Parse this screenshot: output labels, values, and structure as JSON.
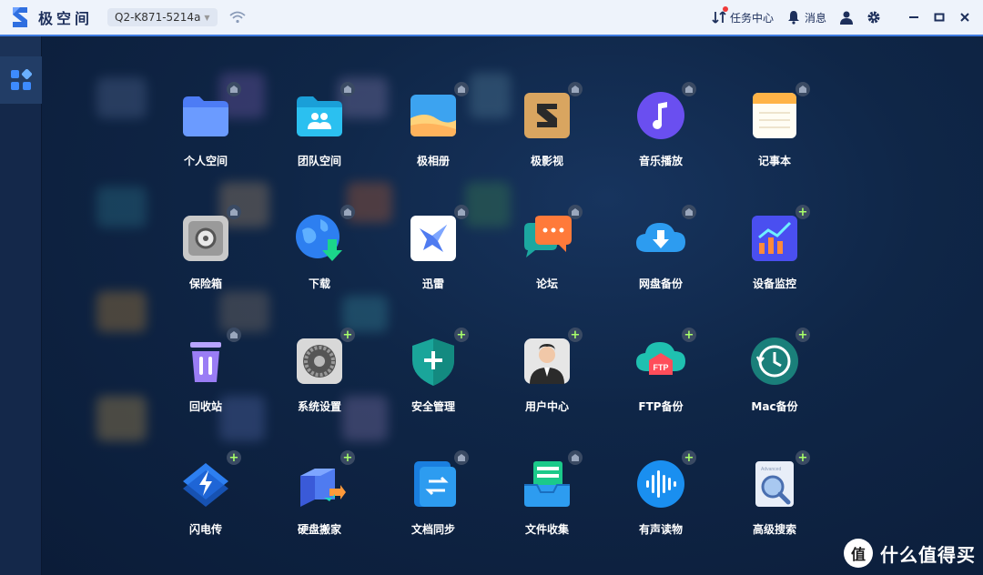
{
  "titlebar": {
    "app_name": "极空间",
    "device_name": "Q2-K871-5214a",
    "task_center": "任务中心",
    "messages": "消息",
    "icons": [
      "wifi-icon",
      "task-center-icon",
      "bell-icon",
      "user-icon",
      "gear-icon",
      "minimize-icon",
      "maximize-icon",
      "close-icon"
    ]
  },
  "sidebar": {
    "items": [
      {
        "icon": "apps-grid-icon",
        "active": true
      }
    ]
  },
  "apps": [
    {
      "label": "个人空间",
      "icon": "folder-icon",
      "badge": "installed"
    },
    {
      "label": "团队空间",
      "icon": "team-folder-icon",
      "badge": "installed"
    },
    {
      "label": "极相册",
      "icon": "photo-album-icon",
      "badge": "installed"
    },
    {
      "label": "极影视",
      "icon": "video-icon",
      "badge": "installed"
    },
    {
      "label": "音乐播放",
      "icon": "music-icon",
      "badge": "installed"
    },
    {
      "label": "记事本",
      "icon": "notepad-icon",
      "badge": "installed"
    },
    {
      "label": "保险箱",
      "icon": "safe-icon",
      "badge": "installed"
    },
    {
      "label": "下载",
      "icon": "download-globe-icon",
      "badge": "installed"
    },
    {
      "label": "迅雷",
      "icon": "xunlei-icon",
      "badge": "installed"
    },
    {
      "label": "论坛",
      "icon": "forum-icon",
      "badge": "installed"
    },
    {
      "label": "网盘备份",
      "icon": "cloud-download-icon",
      "badge": "installed"
    },
    {
      "label": "设备监控",
      "icon": "monitor-chart-icon",
      "badge": "add"
    },
    {
      "label": "回收站",
      "icon": "trash-icon",
      "badge": "installed"
    },
    {
      "label": "系统设置",
      "icon": "settings-gear-icon",
      "badge": "add"
    },
    {
      "label": "安全管理",
      "icon": "shield-plus-icon",
      "badge": "add"
    },
    {
      "label": "用户中心",
      "icon": "user-center-icon",
      "badge": "add"
    },
    {
      "label": "FTP备份",
      "icon": "ftp-cloud-icon",
      "badge": "add"
    },
    {
      "label": "Mac备份",
      "icon": "time-machine-icon",
      "badge": "add"
    },
    {
      "label": "闪电传",
      "icon": "lightning-icon",
      "badge": "add"
    },
    {
      "label": "硬盘搬家",
      "icon": "disk-move-icon",
      "badge": "add"
    },
    {
      "label": "文档同步",
      "icon": "doc-sync-icon",
      "badge": "installed"
    },
    {
      "label": "文件收集",
      "icon": "file-collect-icon",
      "badge": "installed"
    },
    {
      "label": "有声读物",
      "icon": "audiobook-icon",
      "badge": "add"
    },
    {
      "label": "高级搜索",
      "icon": "advanced-search-icon",
      "badge": "add"
    }
  ],
  "search_icon_text": "Advanced",
  "ftp_text": "FTP",
  "watermark": {
    "glyph": "值",
    "text": "什么值得买"
  },
  "colors": {
    "accent": "#3e7be0",
    "badge_plus": "#a8ff6a",
    "background": "#0f2647"
  }
}
